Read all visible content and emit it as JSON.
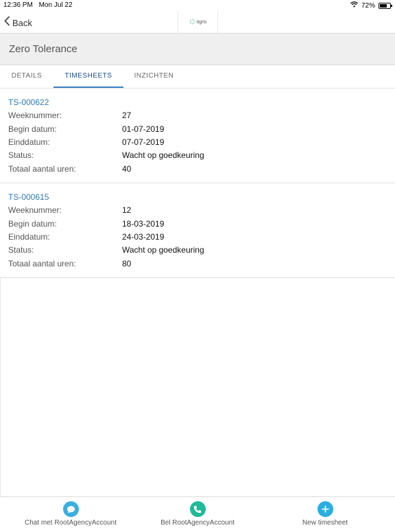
{
  "status_bar": {
    "time": "12:36 PM",
    "date": "Mon Jul 22",
    "battery": "72%",
    "battery_level": 0.72
  },
  "nav": {
    "back_label": "Back",
    "logo_text": "tigris"
  },
  "header": {
    "title": "Zero Tolerance"
  },
  "tabs": [
    {
      "label": "DETAILS",
      "active": false
    },
    {
      "label": "TIMESHEETS",
      "active": true
    },
    {
      "label": "INZICHTEN",
      "active": false
    }
  ],
  "timesheets": [
    {
      "id": "TS-000622",
      "rows": [
        {
          "label": "Weeknummer:",
          "value": "27"
        },
        {
          "label": "Begin datum:",
          "value": "01-07-2019"
        },
        {
          "label": "Einddatum:",
          "value": "07-07-2019"
        },
        {
          "label": "Status:",
          "value": "Wacht op goedkeuring"
        },
        {
          "label": "Totaal aantal uren:",
          "value": "40"
        }
      ]
    },
    {
      "id": "TS-000615",
      "rows": [
        {
          "label": "Weeknummer:",
          "value": "12"
        },
        {
          "label": "Begin datum:",
          "value": "18-03-2019"
        },
        {
          "label": "Einddatum:",
          "value": "24-03-2019"
        },
        {
          "label": "Status:",
          "value": "Wacht op goedkeuring"
        },
        {
          "label": "Totaal aantal uren:",
          "value": "80"
        }
      ]
    }
  ],
  "footer": {
    "chat_label": "Chat met RootAgencyAccount",
    "call_label": "Bel RootAgencyAccount",
    "new_label": "New timesheet"
  },
  "colors": {
    "accent_blue": "#2d7ab8",
    "chat_icon": "#3aafe0",
    "call_icon": "#1fba9a",
    "new_icon": "#2aaee0"
  }
}
